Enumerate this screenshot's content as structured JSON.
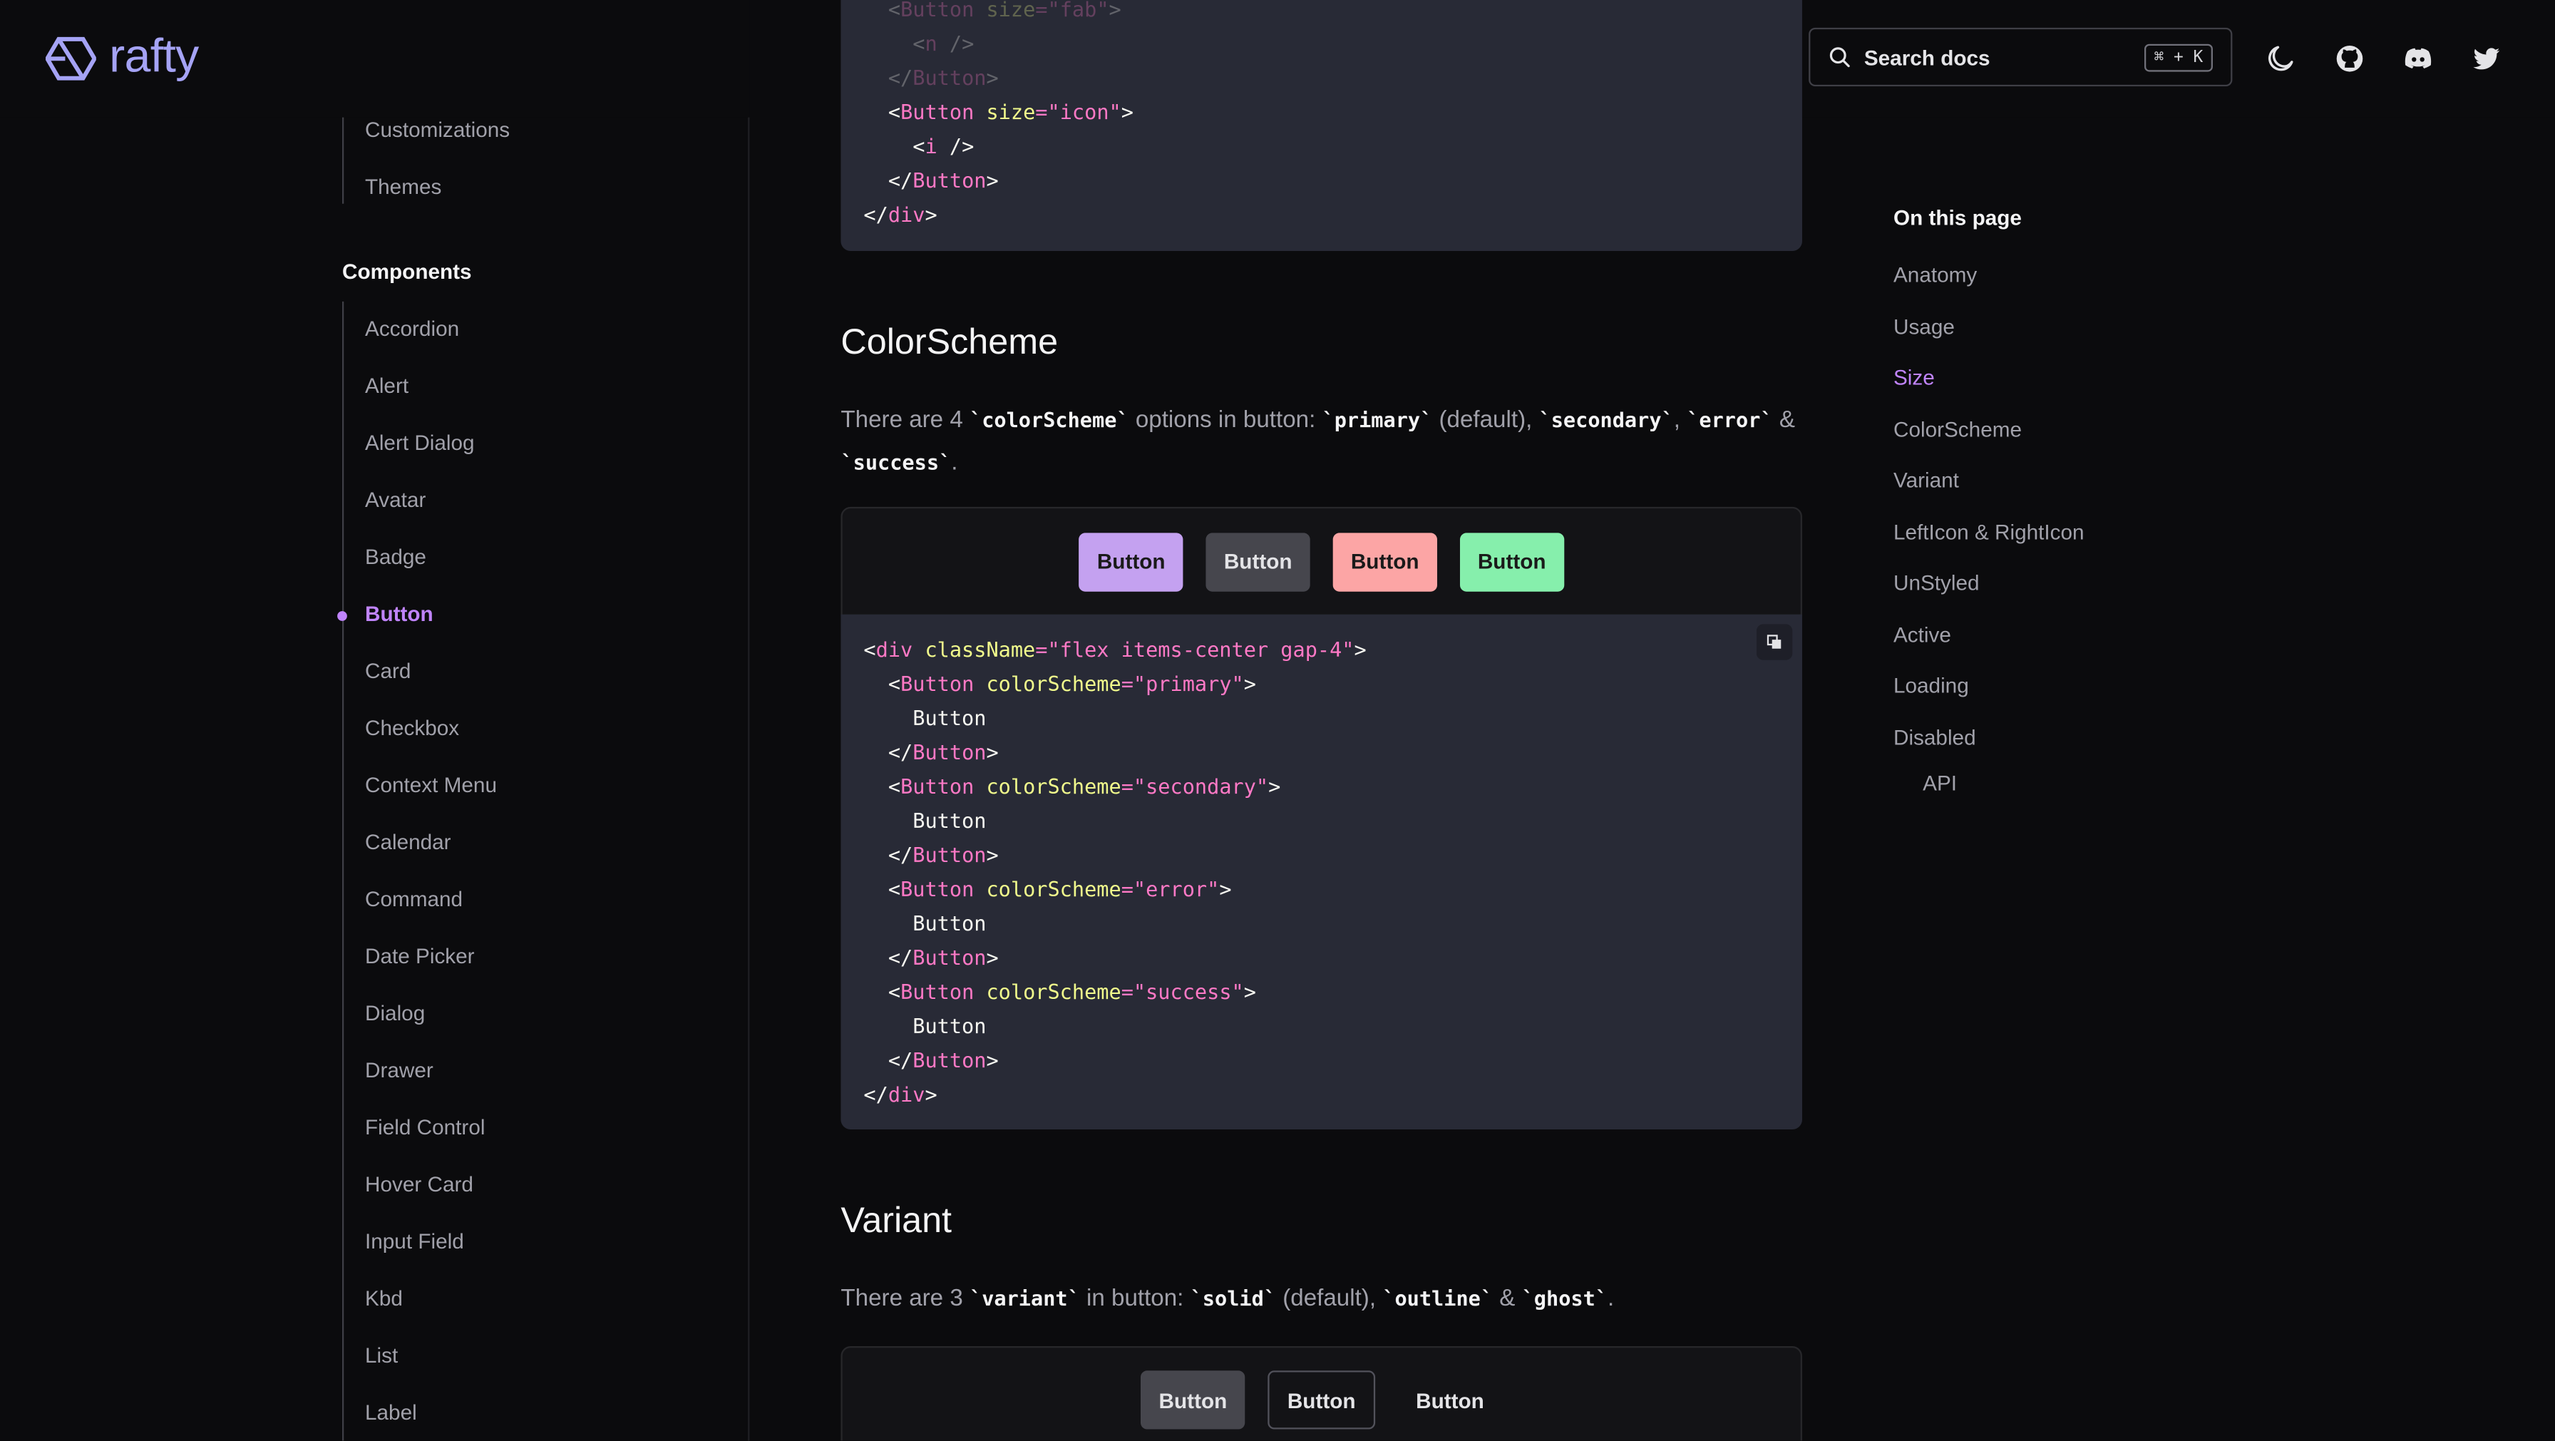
{
  "brand": {
    "name": "rafty"
  },
  "header": {
    "search_placeholder": "Search docs",
    "search_shortcut": "⌘ + K",
    "icons": [
      "moon-icon",
      "github-icon",
      "discord-icon",
      "twitter-icon"
    ]
  },
  "sidebar": {
    "top_items": [
      "Customizations",
      "Themes"
    ],
    "components_heading": "Components",
    "components": [
      "Accordion",
      "Alert",
      "Alert Dialog",
      "Avatar",
      "Badge",
      "Button",
      "Card",
      "Checkbox",
      "Context Menu",
      "Calendar",
      "Command",
      "Date Picker",
      "Dialog",
      "Drawer",
      "Field Control",
      "Hover Card",
      "Input Field",
      "Kbd",
      "List",
      "Label"
    ],
    "active": "Button"
  },
  "main": {
    "top_code": {
      "lines": [
        [
          "<",
          "Button",
          " size",
          "=\"fab\"",
          ">"
        ],
        [
          "<",
          "n",
          " />"
        ],
        [
          "</",
          "Button",
          ">"
        ],
        [
          "<",
          "Button",
          " size",
          "=\"icon\"",
          ">"
        ],
        [
          "<",
          "i",
          " />"
        ],
        [
          "</",
          "Button",
          ">"
        ],
        [
          "</",
          "div",
          ">"
        ]
      ]
    },
    "colorscheme": {
      "title": "ColorScheme",
      "desc_parts": [
        "There are 4 ",
        "`colorScheme`",
        " options in button: ",
        "`primary`",
        " (default), ",
        "`secondary`",
        ", ",
        "`error`",
        " & ",
        "`success`",
        "."
      ],
      "buttons": [
        {
          "label": "Button",
          "bg": "#c4a1f0",
          "fg": "#1a1a1a"
        },
        {
          "label": "Button",
          "bg": "#46464d",
          "fg": "#e4e4e7"
        },
        {
          "label": "Button",
          "bg": "#fca5a5",
          "fg": "#1a1a1a"
        },
        {
          "label": "Button",
          "bg": "#86efac",
          "fg": "#1a1a1a"
        }
      ],
      "code": [
        {
          "indent": "",
          "open": "<",
          "tag": "div",
          "attr": " className",
          "val": "=\"flex items-center gap-4\"",
          "close": ">"
        },
        {
          "indent": "  ",
          "open": "<",
          "tag": "Button",
          "attr": " colorScheme",
          "val": "=\"primary\"",
          "close": ">"
        },
        {
          "indent": "    ",
          "text": "Button"
        },
        {
          "indent": "  ",
          "open": "</",
          "tag": "Button",
          "close": ">"
        },
        {
          "indent": "  ",
          "open": "<",
          "tag": "Button",
          "attr": " colorScheme",
          "val": "=\"secondary\"",
          "close": ">"
        },
        {
          "indent": "    ",
          "text": "Button"
        },
        {
          "indent": "  ",
          "open": "</",
          "tag": "Button",
          "close": ">"
        },
        {
          "indent": "  ",
          "open": "<",
          "tag": "Button",
          "attr": " colorScheme",
          "val": "=\"error\"",
          "close": ">"
        },
        {
          "indent": "    ",
          "text": "Button"
        },
        {
          "indent": "  ",
          "open": "</",
          "tag": "Button",
          "close": ">"
        },
        {
          "indent": "  ",
          "open": "<",
          "tag": "Button",
          "attr": " colorScheme",
          "val": "=\"success\"",
          "close": ">"
        },
        {
          "indent": "    ",
          "text": "Button"
        },
        {
          "indent": "  ",
          "open": "</",
          "tag": "Button",
          "close": ">"
        },
        {
          "indent": "",
          "open": "</",
          "tag": "div",
          "close": ">"
        }
      ]
    },
    "variant": {
      "title": "Variant",
      "desc_parts": [
        "There are 3 ",
        "`variant`",
        " in button: ",
        "`solid`",
        " (default), ",
        "`outline`",
        " & ",
        "`ghost`",
        "."
      ],
      "buttons": [
        {
          "label": "Button",
          "style": "solid"
        },
        {
          "label": "Button",
          "style": "outline"
        },
        {
          "label": "Button",
          "style": "ghost"
        }
      ]
    }
  },
  "toc": {
    "title": "On this page",
    "items": [
      "Anatomy",
      "Usage",
      "Size",
      "ColorScheme",
      "Variant",
      "LeftIcon & RightIcon",
      "UnStyled",
      "Active",
      "Loading",
      "Disabled"
    ],
    "sub_items": [
      "API"
    ],
    "active": "Size"
  },
  "colors": {
    "accent": "#c084fc",
    "logo": "#a5a3f5",
    "code_bg": "#282a36"
  }
}
